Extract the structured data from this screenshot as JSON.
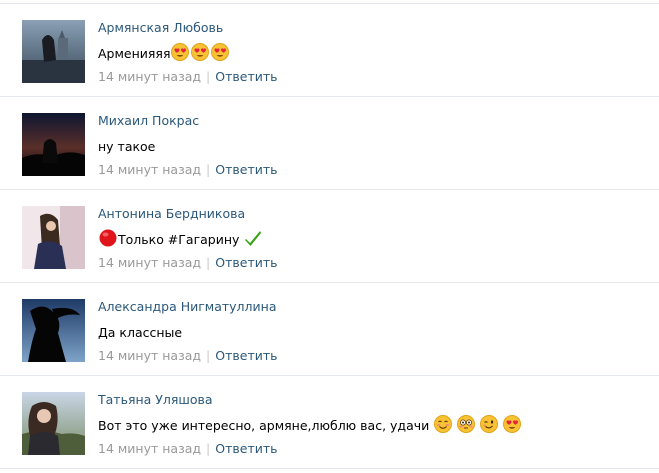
{
  "comments": [
    {
      "author": "Армянская Любовь",
      "text": "Арменияяя",
      "time": "14 минут назад",
      "reply": "Ответить",
      "emojis": [
        "heart-eyes",
        "heart-eyes",
        "heart-eyes"
      ]
    },
    {
      "author": "Михаил Покрас",
      "text": "ну такое",
      "time": "14 минут назад",
      "reply": "Ответить"
    },
    {
      "author": "Антонина Бердникова",
      "text": "Только #Гагарину",
      "time": "14 минут назад",
      "reply": "Ответить",
      "emojis": [
        "red-circle",
        "check-mark"
      ]
    },
    {
      "author": "Александра Нигматуллина",
      "text": "Да классные",
      "time": "14 минут назад",
      "reply": "Ответить"
    },
    {
      "author": "Татьяна Уляшова",
      "text": "Вот это уже интересно, армяне,люблю вас, удачи",
      "time": "14 минут назад",
      "reply": "Ответить",
      "emojis": [
        "smiling-face",
        "flushed-face",
        "winking-face",
        "heart-eyes"
      ]
    }
  ],
  "divider": "|",
  "colors": {
    "link": "#2b587a",
    "meta": "#999999",
    "separator": "#e4e8ed"
  }
}
